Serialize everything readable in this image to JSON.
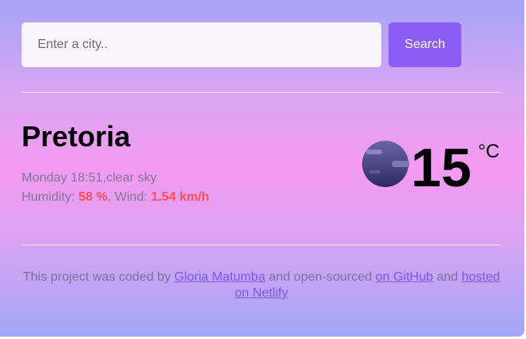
{
  "search": {
    "placeholder": "Enter a city..",
    "value": "",
    "button_label": "Search"
  },
  "weather": {
    "city": "Pretoria",
    "datetime": "Monday 18:51",
    "description": "clear sky",
    "humidity_label": "Humidity: ",
    "humidity_value": "58 %",
    "wind_label": ", Wind: ",
    "wind_value": "1.54 km/h",
    "temperature": "15",
    "unit": "°C",
    "icon": "night-moon-icon"
  },
  "footer": {
    "text1": "This project was coded by ",
    "author_link": "Gloria Matumba",
    "text2": " and open-sourced ",
    "github_link": "on GitHub",
    "text3": " and ",
    "netlify_link": "hosted on Netlify"
  },
  "colors": {
    "button": "#8b5cf6",
    "highlight": "#f7505f",
    "link": "#7a58e8"
  }
}
